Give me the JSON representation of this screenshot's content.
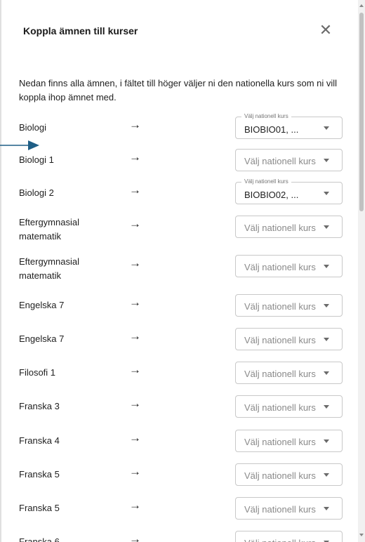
{
  "dialog": {
    "title": "Koppla ämnen till kurser",
    "close_glyph": "✕",
    "intro": "Nedan finns alla ämnen, i fältet till höger väljer ni den nationella kurs som ni vill koppla ihop ämnet med."
  },
  "select_label": "Välj nationell kurs",
  "select_placeholder": "Välj nationell kurs",
  "arrow_glyph": "→",
  "rows": [
    {
      "subject": "Biologi",
      "value": "BIOBIO01, ..."
    },
    {
      "subject": "Biologi 1",
      "value": ""
    },
    {
      "subject": "Biologi 2",
      "value": "BIOBIO02, ..."
    },
    {
      "subject": "Eftergymnasial matematik",
      "value": ""
    },
    {
      "subject": "Eftergymnasial matematik",
      "value": ""
    },
    {
      "subject": "Engelska 7",
      "value": ""
    },
    {
      "subject": "Engelska 7",
      "value": ""
    },
    {
      "subject": "Filosofi 1",
      "value": ""
    },
    {
      "subject": "Franska 3",
      "value": ""
    },
    {
      "subject": "Franska 4",
      "value": ""
    },
    {
      "subject": "Franska 5",
      "value": ""
    },
    {
      "subject": "Franska 5",
      "value": ""
    },
    {
      "subject": "Franska 6",
      "value": ""
    }
  ],
  "colors": {
    "pointer": "#1f5f86",
    "border": "#c8c8c8"
  }
}
